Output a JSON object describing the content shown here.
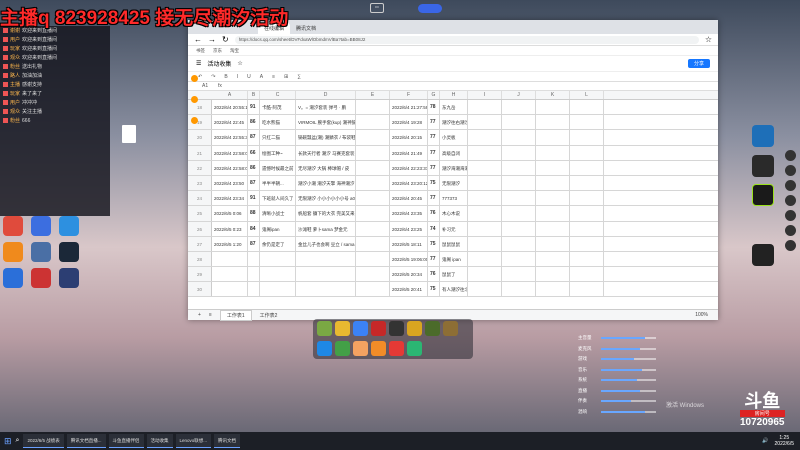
{
  "overlay": {
    "banner": "主播q 823928425 接无尽潮汐活动"
  },
  "chat": {
    "lines": [
      {
        "user": "谢谢",
        "text": "欢迎来到直播间"
      },
      {
        "user": "用户",
        "text": "欢迎来到直播间"
      },
      {
        "user": "玩家",
        "text": "欢迎来到直播间"
      },
      {
        "user": "观众",
        "text": "欢迎来到直播间"
      },
      {
        "user": "粉丝",
        "text": "送出礼物"
      },
      {
        "user": "路人",
        "text": "加油加油"
      },
      {
        "user": "主播",
        "text": "感谢支持"
      },
      {
        "user": "玩家",
        "text": "来了来了"
      },
      {
        "user": "用户",
        "text": "冲冲冲"
      },
      {
        "user": "观众",
        "text": "关注主播"
      },
      {
        "user": "粉丝",
        "text": "666"
      }
    ]
  },
  "desktop": {
    "left_icons": [
      {
        "name": "app-1",
        "label": "",
        "color": "#e04b3c"
      },
      {
        "name": "app-2",
        "label": "",
        "color": "#3c6ee0"
      },
      {
        "name": "app-3",
        "label": "",
        "color": "#2d90e0"
      },
      {
        "name": "app-4",
        "label": "",
        "color": "#f08a1c"
      },
      {
        "name": "app-5",
        "label": "",
        "color": "#4a6fa5"
      },
      {
        "name": "steam",
        "label": "",
        "color": "#1b2838"
      },
      {
        "name": "app-7",
        "label": "",
        "color": "#2b6fd9"
      },
      {
        "name": "app-8",
        "label": "",
        "color": "#c33"
      },
      {
        "name": "app-9",
        "label": "",
        "color": "#2c3e73"
      }
    ]
  },
  "browser": {
    "tabs": [
      "在线编辑",
      "腾讯文档"
    ],
    "url": "https://docs.qq.com/sheet/DVFdxaWlObmdmVlBa?tab=BB08J2",
    "bookmarks": [
      "书签",
      "京东",
      "淘宝"
    ],
    "doc_title": "活动收集",
    "share_label": "分享",
    "toolbar": [
      "↶",
      "↷",
      "B",
      "I",
      "U",
      "A",
      "≡",
      "⊞",
      "∑"
    ],
    "cell_ref": "A1",
    "formula_value": "",
    "columns": [
      "A",
      "B",
      "C",
      "D",
      "E",
      "F",
      "G",
      "H",
      "I",
      "J",
      "K",
      "L"
    ],
    "rows": [
      {
        "num": "18",
        "date": "2022/6/4 20:55:15",
        "qty": "91",
        "name": "卡酷-阿茂",
        "items": "V。= 潮汐套装 弹弓 · 鹏",
        "time": "2022/6/4 21:27:59",
        "score": "78",
        "note": "东九岳"
      },
      {
        "num": "19",
        "date": "2022/6/4 22:45",
        "qty": "86",
        "name": "吃水熊猫",
        "items": "VIRMOIL 腕手套(kup) 潮神鼓",
        "time": "2022/6/4 19:28",
        "score": "77",
        "note": "潮汐往右潮汐泡"
      },
      {
        "num": "20",
        "date": "2022/6/4 22:55:37",
        "qty": "87",
        "name": "只红二猫",
        "items": "锅碗瓢盆(潮) 潮鳞衣 / 布袋鞋",
        "time": "2022/6/4 20:15",
        "score": "77",
        "note": "小灵板"
      },
      {
        "num": "21",
        "date": "2022/6/4 22:58:02",
        "qty": "66",
        "name": "绘图工种~",
        "items": "长款天行者 潮汐 马赛克套装 / 臂",
        "time": "2022/6/4 21:49",
        "score": "77",
        "note": "高级自闭"
      },
      {
        "num": "22",
        "date": "2022/6/4 22:58:05",
        "qty": "86",
        "name": "遗憾时候最之前",
        "items": "无尽潮汐 大锅 棒球帽 / 皮",
        "time": "2022/6/4 22:23:37",
        "score": "77",
        "note": "潮汐海潮海潮"
      },
      {
        "num": "23",
        "date": "2022/6/4 23:50",
        "qty": "87",
        "name": "半半半朝...",
        "items": "潮汐小潮 潮汐天擎 海神潮汐",
        "time": "2022/6/4 23:20:12",
        "score": "75",
        "note": "无限潮汐"
      },
      {
        "num": "24",
        "date": "2022/6/4 23:34",
        "qty": "91",
        "name": "下班就人间久了",
        "items": "无限潮汐 小小小小小小号 a0034767",
        "time": "2022/6/4 20:45",
        "score": "77",
        "note": "777373"
      },
      {
        "num": "25",
        "date": "2022/6/5 0:06",
        "qty": "88",
        "name": "清晰小战士",
        "items": "帆船套 镰下的大衣 完美又来了哇",
        "time": "2022/6/4 23:35",
        "score": "76",
        "note": "木心木说"
      },
      {
        "num": "26",
        "date": "2022/6/5 0:23",
        "qty": "84",
        "name": "鬼阁ipan",
        "items": "沙滩鞋 萝卜sama 梦金元",
        "time": "2022/6/4 23:25",
        "score": "74",
        "note": "补习元"
      },
      {
        "num": "27",
        "date": "2022/6/5 1:20",
        "qty": "87",
        "name": "余仍是定了",
        "items": "金丝儿子也会啊 豆立 / sama 海蓝海",
        "time": "2022/6/5 18:11",
        "score": "75",
        "note": "鼠鼠鼠鼠"
      },
      {
        "num": "28",
        "date": "",
        "qty": "",
        "name": "",
        "items": "",
        "time": "2022/6/5 19:06:00",
        "score": "77",
        "note": "鬼阁 ipan"
      },
      {
        "num": "29",
        "date": "",
        "qty": "",
        "name": "",
        "items": "",
        "time": "2022/6/5 20:34",
        "score": "76",
        "note": "鼠鼠了"
      },
      {
        "num": "30",
        "date": "",
        "qty": "",
        "name": "",
        "items": "",
        "time": "2022/6/5 20:41",
        "score": "75",
        "note": "有人潮汐往北城"
      }
    ],
    "sheet_tabs": [
      "工作表1",
      "工作表2"
    ],
    "zoom": "100%"
  },
  "dock_colors": [
    "#7aa843",
    "#e8b930",
    "#3b82f6",
    "#c62828",
    "#333",
    "#d9a520",
    "#4b6b2a",
    "#8d6e35",
    "#1e88e5",
    "#43a047",
    "#f4a261",
    "#f28c28",
    "#e53935",
    "#2bb673"
  ],
  "sliders": [
    {
      "label": "主音量",
      "value": 0.8
    },
    {
      "label": "麦克风",
      "value": 0.7
    },
    {
      "label": "游戏",
      "value": 0.6
    },
    {
      "label": "音乐",
      "value": 0.75
    },
    {
      "label": "系统",
      "value": 0.65
    },
    {
      "label": "直播",
      "value": 0.7
    },
    {
      "label": "伴奏",
      "value": 0.55
    },
    {
      "label": "混响",
      "value": 0.8
    }
  ],
  "taskbar": {
    "items": [
      "2022/6/5 战绩表",
      "腾讯文档直播...",
      "斗鱼直播伴侣",
      "活动收集",
      "Lenovo联想...",
      "腾讯文档"
    ],
    "clock": "1:25",
    "date": "2022/6/5"
  },
  "watermark": {
    "activate": "激活 Windows",
    "brand": "斗鱼",
    "room_label": "房间号",
    "room_number": "10720965"
  }
}
